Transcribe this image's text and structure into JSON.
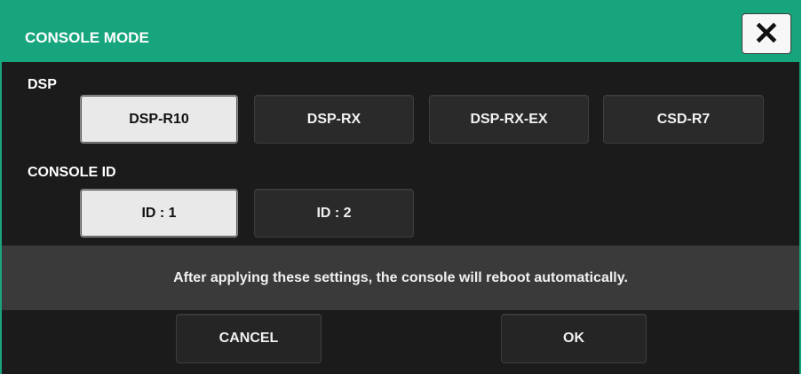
{
  "dialog": {
    "title": "CONSOLE MODE",
    "close_icon": "close-icon"
  },
  "dsp": {
    "label": "DSP",
    "options": [
      "DSP-R10",
      "DSP-RX",
      "DSP-RX-EX",
      "CSD-R7"
    ],
    "selected": "DSP-R10"
  },
  "console_id": {
    "label": "CONSOLE ID",
    "options": [
      "ID : 1",
      "ID : 2"
    ],
    "selected": "ID : 1"
  },
  "notice": "After applying these settings, the console will reboot automatically.",
  "footer": {
    "cancel_label": "CANCEL",
    "ok_label": "OK"
  },
  "colors": {
    "accent": "#17a57d",
    "background": "#1b1b1b",
    "notice_bg": "#3a3a3a",
    "button": "#2a2a2a",
    "active_button": "#e9e9e9"
  }
}
